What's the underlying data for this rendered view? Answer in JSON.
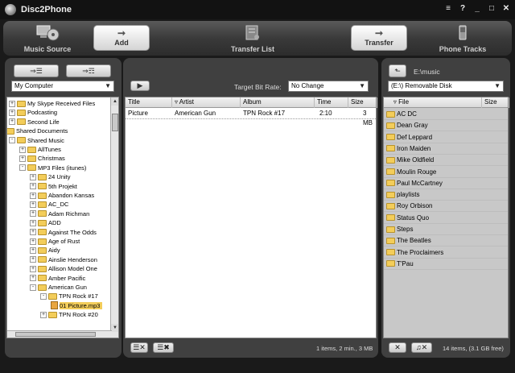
{
  "app": {
    "title": "Disc2Phone"
  },
  "window_controls": [
    "≡",
    "?",
    "_",
    "□",
    "✕"
  ],
  "toolbar": {
    "music_source": "Music Source",
    "add": "Add",
    "transfer_list": "Transfer List",
    "transfer": "Transfer",
    "phone_tracks": "Phone Tracks"
  },
  "left": {
    "location_select": "My Computer",
    "tree": [
      {
        "label": "My Skype Received Files",
        "indent": 0,
        "expander": "+"
      },
      {
        "label": "Podcasting",
        "indent": 0,
        "expander": "+"
      },
      {
        "label": "Second Life",
        "indent": 0,
        "expander": "+"
      },
      {
        "label": "Shared Documents",
        "indent": -1,
        "expander": ""
      },
      {
        "label": "Shared Music",
        "indent": 0,
        "expander": "-"
      },
      {
        "label": "AllTunes",
        "indent": 1,
        "expander": "+"
      },
      {
        "label": "Christmas",
        "indent": 1,
        "expander": "+"
      },
      {
        "label": "MP3 Files (itunes)",
        "indent": 1,
        "expander": "-"
      },
      {
        "label": "24 Unity",
        "indent": 2,
        "expander": "+"
      },
      {
        "label": "5th Projekt",
        "indent": 2,
        "expander": "+"
      },
      {
        "label": "Abandon Kansas",
        "indent": 2,
        "expander": "+"
      },
      {
        "label": "AC_DC",
        "indent": 2,
        "expander": "+"
      },
      {
        "label": "Adam Richman",
        "indent": 2,
        "expander": "+"
      },
      {
        "label": "ADD",
        "indent": 2,
        "expander": "+"
      },
      {
        "label": "Against The Odds",
        "indent": 2,
        "expander": "+"
      },
      {
        "label": "Age of Rust",
        "indent": 2,
        "expander": "+"
      },
      {
        "label": "Aidy",
        "indent": 2,
        "expander": "+"
      },
      {
        "label": "Ainslie Henderson",
        "indent": 2,
        "expander": "+"
      },
      {
        "label": "Allison Model One",
        "indent": 2,
        "expander": "+"
      },
      {
        "label": "Amber Pacific",
        "indent": 2,
        "expander": "+"
      },
      {
        "label": "American Gun",
        "indent": 2,
        "expander": "-"
      },
      {
        "label": "TPN Rock #17",
        "indent": 3,
        "expander": "-"
      },
      {
        "label": "01 Picture.mp3",
        "indent": 4,
        "expander": "",
        "file": true,
        "selected": true
      },
      {
        "label": "TPN Rock #20",
        "indent": 3,
        "expander": "+"
      }
    ]
  },
  "middle": {
    "target_bit_rate_label": "Target Bit Rate:",
    "bit_rate_select": "No Change",
    "columns": [
      "Title",
      "Artist",
      "Album",
      "Time",
      "Size"
    ],
    "rows": [
      {
        "title": "Picture",
        "artist": "American Gun",
        "album": "TPN Rock #17",
        "time": "2:10",
        "size": "3 MB"
      }
    ],
    "status": "1 items, 2 min., 3 MB"
  },
  "right": {
    "path": "E:\\music",
    "drive_select": "(E:\\) Removable Disk",
    "columns": [
      "File",
      "Size"
    ],
    "folders": [
      "AC DC",
      "Dean Gray",
      "Def Leppard",
      "Iron Maiden",
      "Mike Oldfield",
      "Moulin Rouge",
      "Paul McCartney",
      "playlists",
      "Roy Orbison",
      "Status Quo",
      "Steps",
      "The Beatles",
      "The Proclaimers",
      "T'Pau"
    ],
    "status": "14 items, (3.1 GB free)"
  }
}
